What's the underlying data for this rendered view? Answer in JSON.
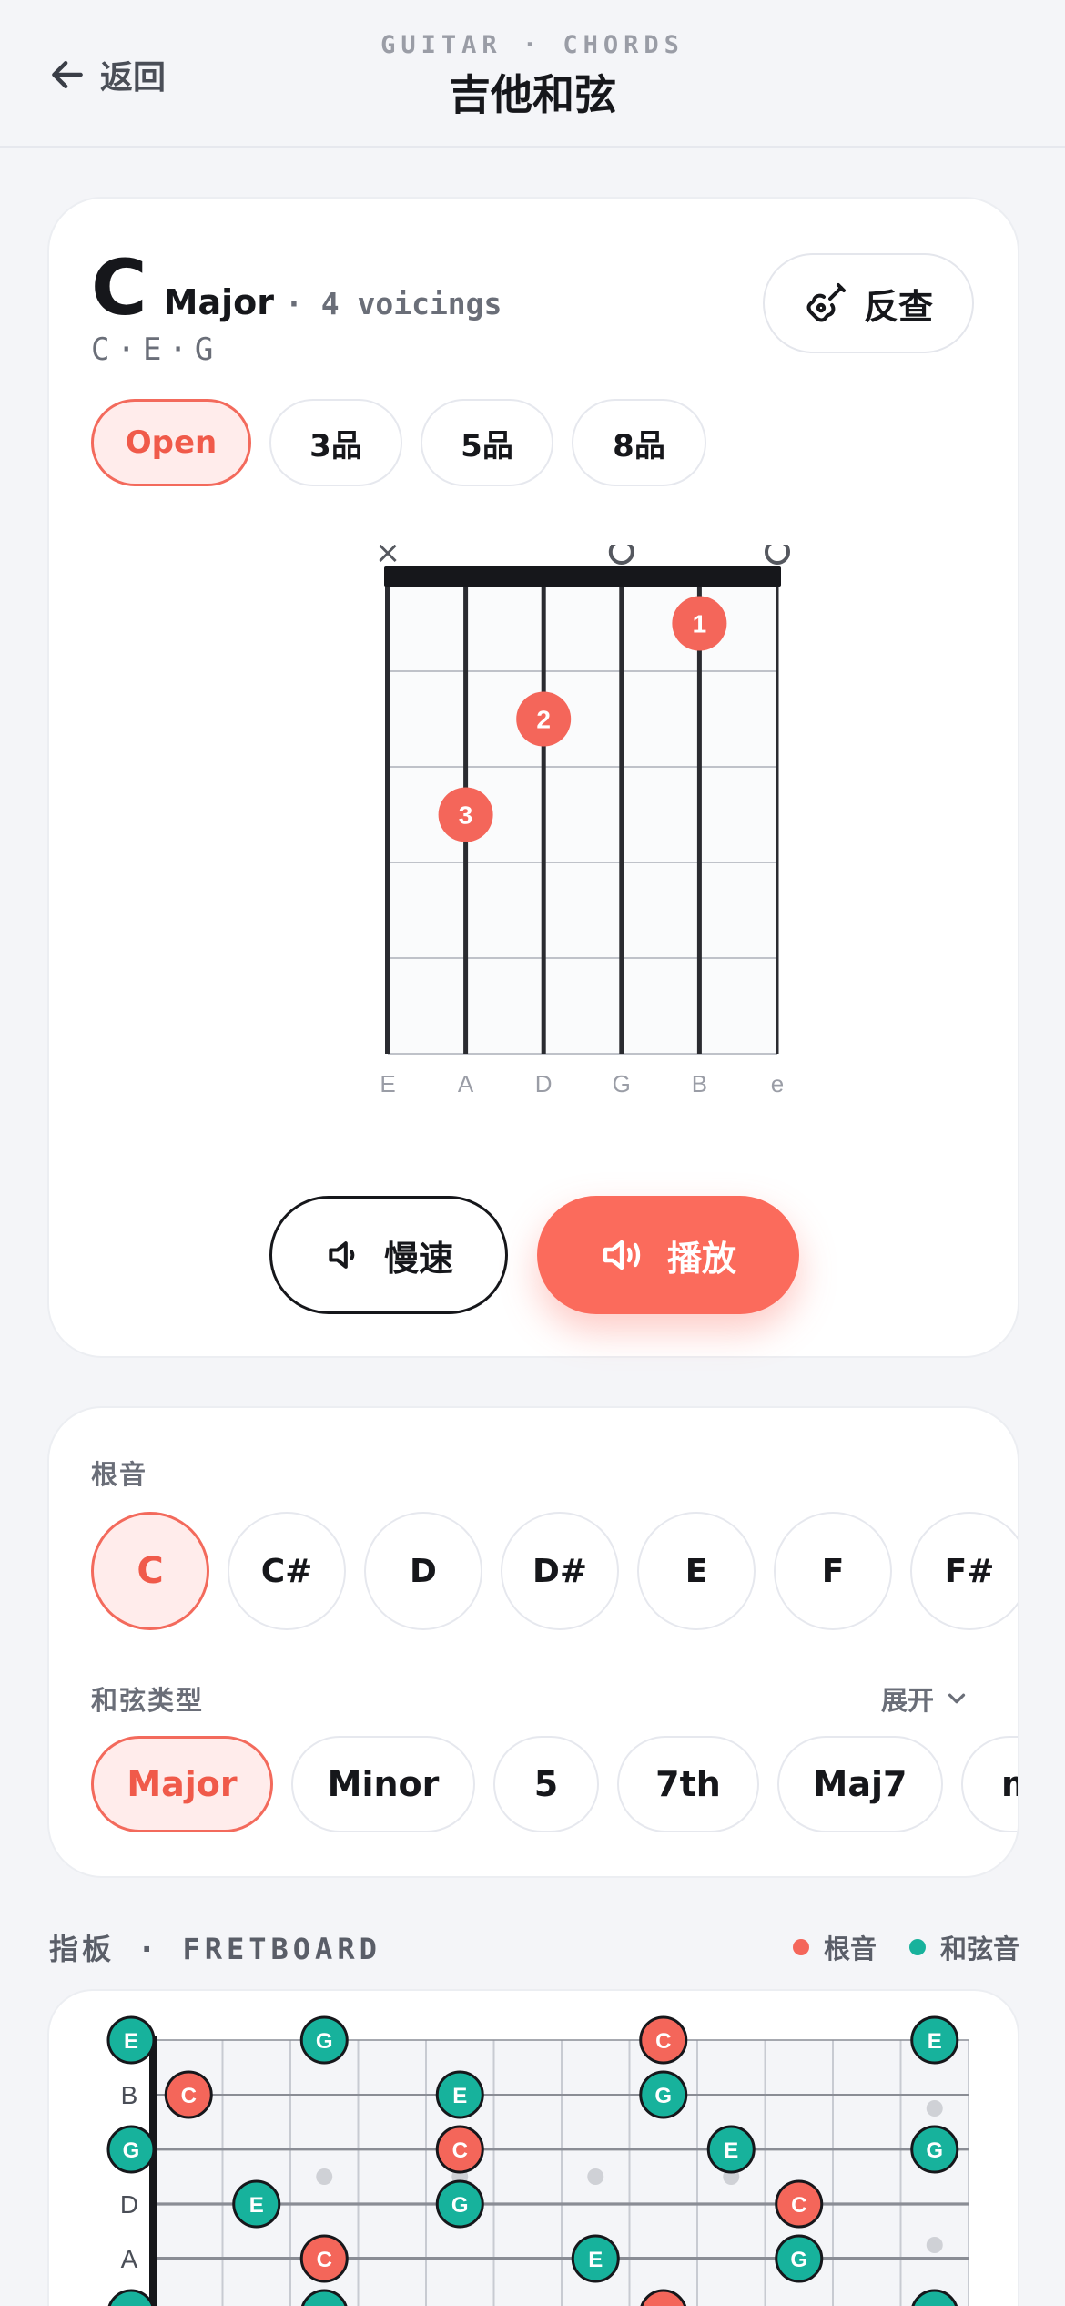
{
  "header": {
    "back_label": "返回",
    "subtitle": "GUITAR · CHORDS",
    "title": "吉他和弦"
  },
  "chord": {
    "root": "C",
    "quality": "Major",
    "voicings": "· 4 voicings",
    "notes": "C·E·G",
    "lookup_label": "反查",
    "positions": [
      {
        "label": "Open",
        "active": true
      },
      {
        "label": "3品",
        "active": false
      },
      {
        "label": "5品",
        "active": false
      },
      {
        "label": "8品",
        "active": false
      }
    ],
    "diagram": {
      "strings": [
        "E",
        "A",
        "D",
        "G",
        "B",
        "e"
      ],
      "string_markers": [
        "x",
        "",
        "",
        "o",
        "",
        "o"
      ],
      "fingers": [
        {
          "string": 5,
          "fret": 1,
          "finger": "1"
        },
        {
          "string": 4,
          "fret": 2,
          "finger": "2"
        },
        {
          "string": 2,
          "fret": 3,
          "finger": "3"
        }
      ],
      "frets_shown": 5,
      "accent_color": "#f4665a"
    },
    "slow_label": "慢速",
    "play_label": "播放"
  },
  "selector": {
    "root_label": "根音",
    "roots": [
      {
        "label": "C",
        "active": true
      },
      {
        "label": "C#",
        "active": false
      },
      {
        "label": "D",
        "active": false
      },
      {
        "label": "D#",
        "active": false
      },
      {
        "label": "E",
        "active": false
      },
      {
        "label": "F",
        "active": false
      },
      {
        "label": "F#",
        "active": false
      }
    ],
    "type_label": "和弦类型",
    "expand_label": "展开",
    "types": [
      {
        "label": "Major",
        "active": true
      },
      {
        "label": "Minor",
        "active": false
      },
      {
        "label": "5",
        "active": false
      },
      {
        "label": "7th",
        "active": false
      },
      {
        "label": "Maj7",
        "active": false
      },
      {
        "label": "m",
        "active": false
      }
    ]
  },
  "fretboard": {
    "title_cn": "指板",
    "title_sep": "·",
    "title_en": "FRETBOARD",
    "legend_root": "根音",
    "legend_tone": "和弦音",
    "root_color": "#f4665a",
    "tone_color": "#17b29c",
    "string_labels": [
      "",
      "B",
      "",
      "D",
      "A",
      ""
    ],
    "notes": [
      {
        "string": 0,
        "fret": 0,
        "label": "E",
        "root": false
      },
      {
        "string": 0,
        "fret": 3,
        "label": "G",
        "root": false
      },
      {
        "string": 0,
        "fret": 8,
        "label": "C",
        "root": true
      },
      {
        "string": 0,
        "fret": 12,
        "label": "E",
        "root": false
      },
      {
        "string": 1,
        "fret": 1,
        "label": "C",
        "root": true
      },
      {
        "string": 1,
        "fret": 5,
        "label": "E",
        "root": false
      },
      {
        "string": 1,
        "fret": 8,
        "label": "G",
        "root": false
      },
      {
        "string": 2,
        "fret": 0,
        "label": "G",
        "root": false
      },
      {
        "string": 2,
        "fret": 5,
        "label": "C",
        "root": true
      },
      {
        "string": 2,
        "fret": 9,
        "label": "E",
        "root": false
      },
      {
        "string": 2,
        "fret": 12,
        "label": "G",
        "root": false
      },
      {
        "string": 3,
        "fret": 2,
        "label": "E",
        "root": false
      },
      {
        "string": 3,
        "fret": 5,
        "label": "G",
        "root": false
      },
      {
        "string": 3,
        "fret": 10,
        "label": "C",
        "root": true
      },
      {
        "string": 4,
        "fret": 3,
        "label": "C",
        "root": true
      },
      {
        "string": 4,
        "fret": 7,
        "label": "E",
        "root": false
      },
      {
        "string": 4,
        "fret": 10,
        "label": "G",
        "root": false
      },
      {
        "string": 5,
        "fret": 0,
        "label": "",
        "root": false
      },
      {
        "string": 5,
        "fret": 3,
        "label": "",
        "root": false
      },
      {
        "string": 5,
        "fret": 8,
        "label": "",
        "root": true
      },
      {
        "string": 5,
        "fret": 12,
        "label": "",
        "root": false
      }
    ],
    "inlays": [
      3,
      5,
      7,
      9,
      12
    ]
  }
}
